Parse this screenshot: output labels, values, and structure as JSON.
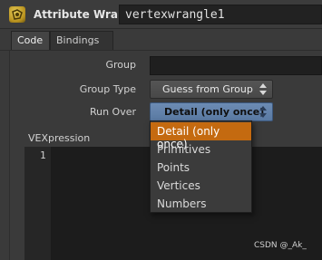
{
  "header": {
    "node_type": "Attribute Wrangle",
    "node_name": "vertexwrangle1",
    "node_icon": "wrangle-node-icon"
  },
  "tabs": [
    {
      "label": "Code",
      "active": true
    },
    {
      "label": "Bindings",
      "active": false
    }
  ],
  "params": {
    "group_label": "Group",
    "group_value": "",
    "group_type_label": "Group Type",
    "group_type_value": "Guess from Group",
    "run_over_label": "Run Over",
    "run_over_value": "Detail (only once)",
    "vexpression_label": "VEXpression"
  },
  "editor": {
    "line_numbers": [
      "1"
    ],
    "code": ""
  },
  "dropdown": {
    "options": [
      "Detail (only once)",
      "Primitives",
      "Points",
      "Vertices",
      "Numbers"
    ],
    "selected": "Detail (only once)"
  },
  "colors": {
    "accent_selected": "#c46a10",
    "runover_button": "#6c8bb3"
  },
  "watermark": "CSDN @_Ak_"
}
